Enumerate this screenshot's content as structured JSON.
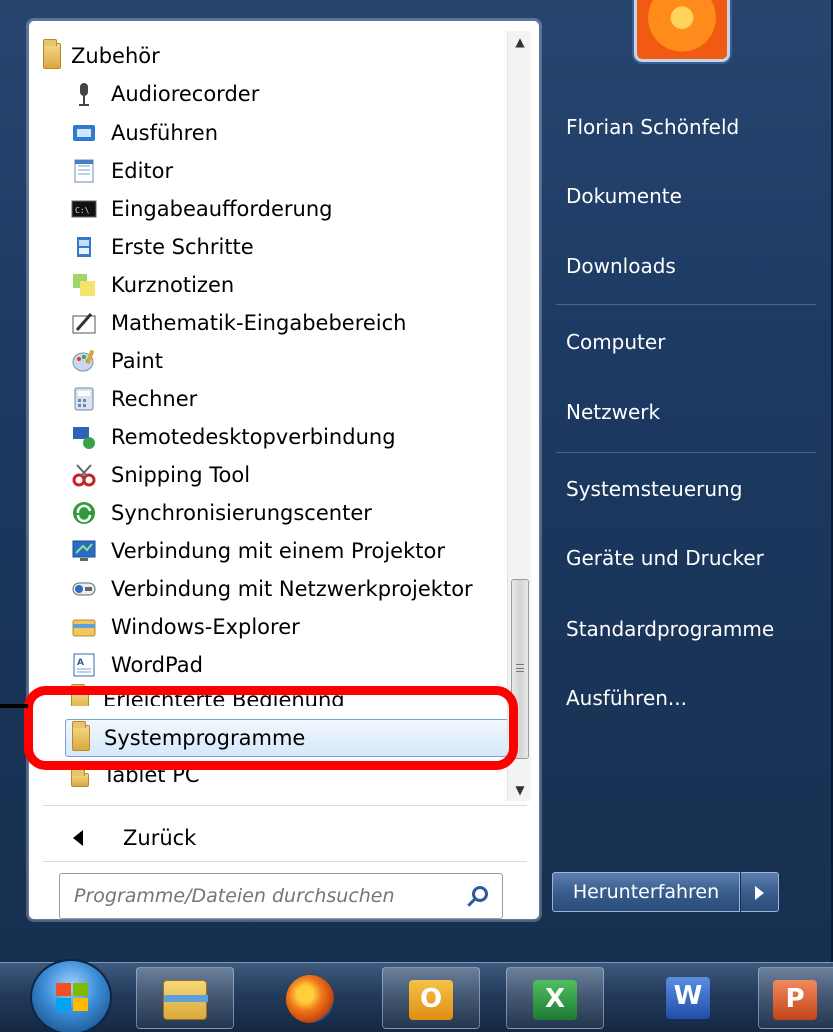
{
  "program_list": {
    "folder_open": "Zubehör",
    "items": [
      {
        "label": "Audiorecorder",
        "icon": "microphone-icon"
      },
      {
        "label": "Ausführen",
        "icon": "run-icon"
      },
      {
        "label": "Editor",
        "icon": "notepad-icon"
      },
      {
        "label": "Eingabeaufforderung",
        "icon": "cmd-icon"
      },
      {
        "label": "Erste Schritte",
        "icon": "getting-started-icon"
      },
      {
        "label": "Kurznotizen",
        "icon": "sticky-notes-icon"
      },
      {
        "label": "Mathematik-Eingabebereich",
        "icon": "math-input-icon"
      },
      {
        "label": "Paint",
        "icon": "paint-icon"
      },
      {
        "label": "Rechner",
        "icon": "calculator-icon"
      },
      {
        "label": "Remotedesktopverbindung",
        "icon": "remote-desktop-icon"
      },
      {
        "label": "Snipping Tool",
        "icon": "snipping-tool-icon"
      },
      {
        "label": "Synchronisierungscenter",
        "icon": "sync-center-icon"
      },
      {
        "label": "Verbindung mit einem Projektor",
        "icon": "projector-icon"
      },
      {
        "label": "Verbindung mit Netzwerkprojektor",
        "icon": "network-projector-icon"
      },
      {
        "label": "Windows-Explorer",
        "icon": "explorer-icon"
      },
      {
        "label": "WordPad",
        "icon": "wordpad-icon"
      },
      {
        "label": "Erleichterte Bedienung",
        "icon": "folder-icon"
      },
      {
        "label": "Systemprogramme",
        "icon": "folder-icon"
      },
      {
        "label": "Tablet PC",
        "icon": "folder-icon"
      }
    ],
    "selected_index": 17
  },
  "back": {
    "label": "Zurück"
  },
  "search": {
    "placeholder": "Programme/Dateien durchsuchen"
  },
  "right_pane": {
    "user": "Florian Schönfeld",
    "documents": "Dokumente",
    "downloads": "Downloads",
    "computer": "Computer",
    "network": "Netzwerk",
    "control_panel": "Systemsteuerung",
    "devices": "Geräte und Drucker",
    "default_programs": "Standardprogramme",
    "run": "Ausführen..."
  },
  "shutdown": {
    "label": "Herunterfahren"
  },
  "taskbar": {
    "pinned": [
      {
        "name": "explorer",
        "icon": "explorer-icon"
      },
      {
        "name": "firefox",
        "icon": "firefox-icon"
      },
      {
        "name": "outlook",
        "icon": "outlook-icon",
        "letter": "O"
      },
      {
        "name": "excel",
        "icon": "excel-icon",
        "letter": "X"
      },
      {
        "name": "word",
        "icon": "word-icon",
        "letter": "W"
      },
      {
        "name": "powerpoint",
        "icon": "powerpoint-icon",
        "letter": "P"
      }
    ]
  },
  "colors": {
    "highlight": "#ff0000",
    "menu_bg": "#1d3a63",
    "selection": "#d5e8fb"
  }
}
